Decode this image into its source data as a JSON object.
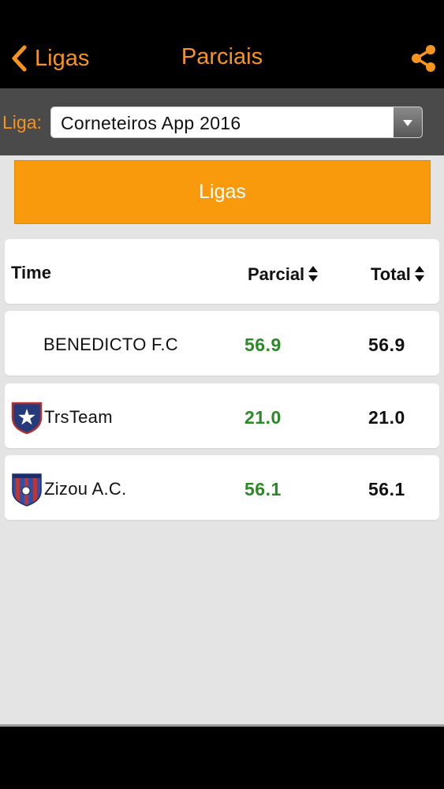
{
  "colors": {
    "accent": "#f7941d",
    "button": "#f99a0c",
    "positive": "#2a8a25",
    "header_bg": "#000000",
    "league_bar_bg": "#4a4a4a",
    "page_bg": "#e4e4e4"
  },
  "nav": {
    "back_label": "Ligas",
    "back_icon": "chevron-left-icon",
    "title": "Parciais",
    "share_icon": "share-icon"
  },
  "league": {
    "label": "Liga:",
    "selected": "Corneteiros App 2016",
    "arrow_icon": "triangle-down-icon"
  },
  "ligas_button": {
    "label": "Ligas"
  },
  "table": {
    "headers": {
      "time": "Time",
      "parcial": "Parcial",
      "total": "Total",
      "sort_icon": "sort-icon"
    },
    "rows": [
      {
        "team": "BENEDICTO F.C",
        "parcial": "56.9",
        "total": "56.9",
        "logo": "none"
      },
      {
        "team": "TrsTeam",
        "parcial": "21.0",
        "total": "21.0",
        "logo": "star-shield-icon"
      },
      {
        "team": "Zizou A.C.",
        "parcial": "56.1",
        "total": "56.1",
        "logo": "striped-shield-icon"
      }
    ]
  }
}
